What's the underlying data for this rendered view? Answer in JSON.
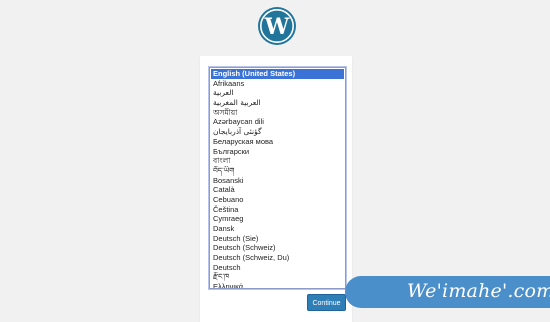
{
  "logo": {
    "icon": "wordpress-logo-icon",
    "color": "#21759b"
  },
  "language_list": {
    "selected_index": 0,
    "items": [
      "English (United States)",
      "Afrikaans",
      "العربية",
      "العربية المغربية",
      "অসমীয়া",
      "Azərbaycan dili",
      "گؤنئی آذربایجان",
      "Беларуская мова",
      "Български",
      "বাংলা",
      "བོད་ཡིག",
      "Bosanski",
      "Català",
      "Cebuano",
      "Čeština",
      "Cymraeg",
      "Dansk",
      "Deutsch (Sie)",
      "Deutsch (Schweiz)",
      "Deutsch (Schweiz, Du)",
      "Deutsch",
      "རྫོང་ཁ",
      "Ελληνικά"
    ]
  },
  "continue_button": {
    "label": "Continue",
    "color": "#2e7eb8"
  },
  "watermark": {
    "text": "We'imahe'.com",
    "color": "#4b8fca"
  }
}
